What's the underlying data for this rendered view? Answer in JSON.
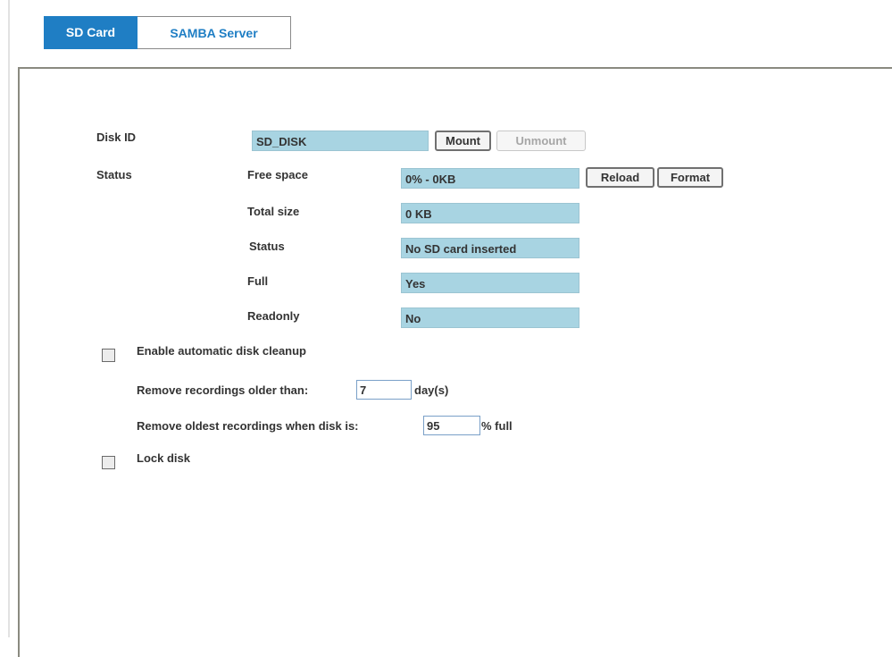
{
  "tabs": {
    "sd_card": "SD Card",
    "samba_server": "SAMBA Server"
  },
  "disk": {
    "id_label": "Disk ID",
    "id_value": "SD_DISK",
    "mount_button": "Mount",
    "unmount_button": "Unmount"
  },
  "status": {
    "section_label": "Status",
    "free_space_label": "Free space",
    "free_space_value": "0% - 0KB",
    "reload_button": "Reload",
    "format_button": "Format",
    "total_size_label": "Total size",
    "total_size_value": "0 KB",
    "status_label": "Status",
    "status_value": "No SD card inserted",
    "full_label": "Full",
    "full_value": "Yes",
    "readonly_label": "Readonly",
    "readonly_value": "No"
  },
  "cleanup": {
    "enable_label": "Enable automatic disk cleanup",
    "enabled": false,
    "older_than_label": "Remove recordings older than:",
    "older_than_value": "7",
    "older_than_unit": "day(s)",
    "disk_full_label": "Remove oldest recordings when disk is:",
    "disk_full_value": "95",
    "disk_full_unit": "% full"
  },
  "lock": {
    "label": "Lock disk",
    "enabled": false
  },
  "colors": {
    "tab_active": "#1f7ec4",
    "field_background": "#a8d4e2"
  }
}
